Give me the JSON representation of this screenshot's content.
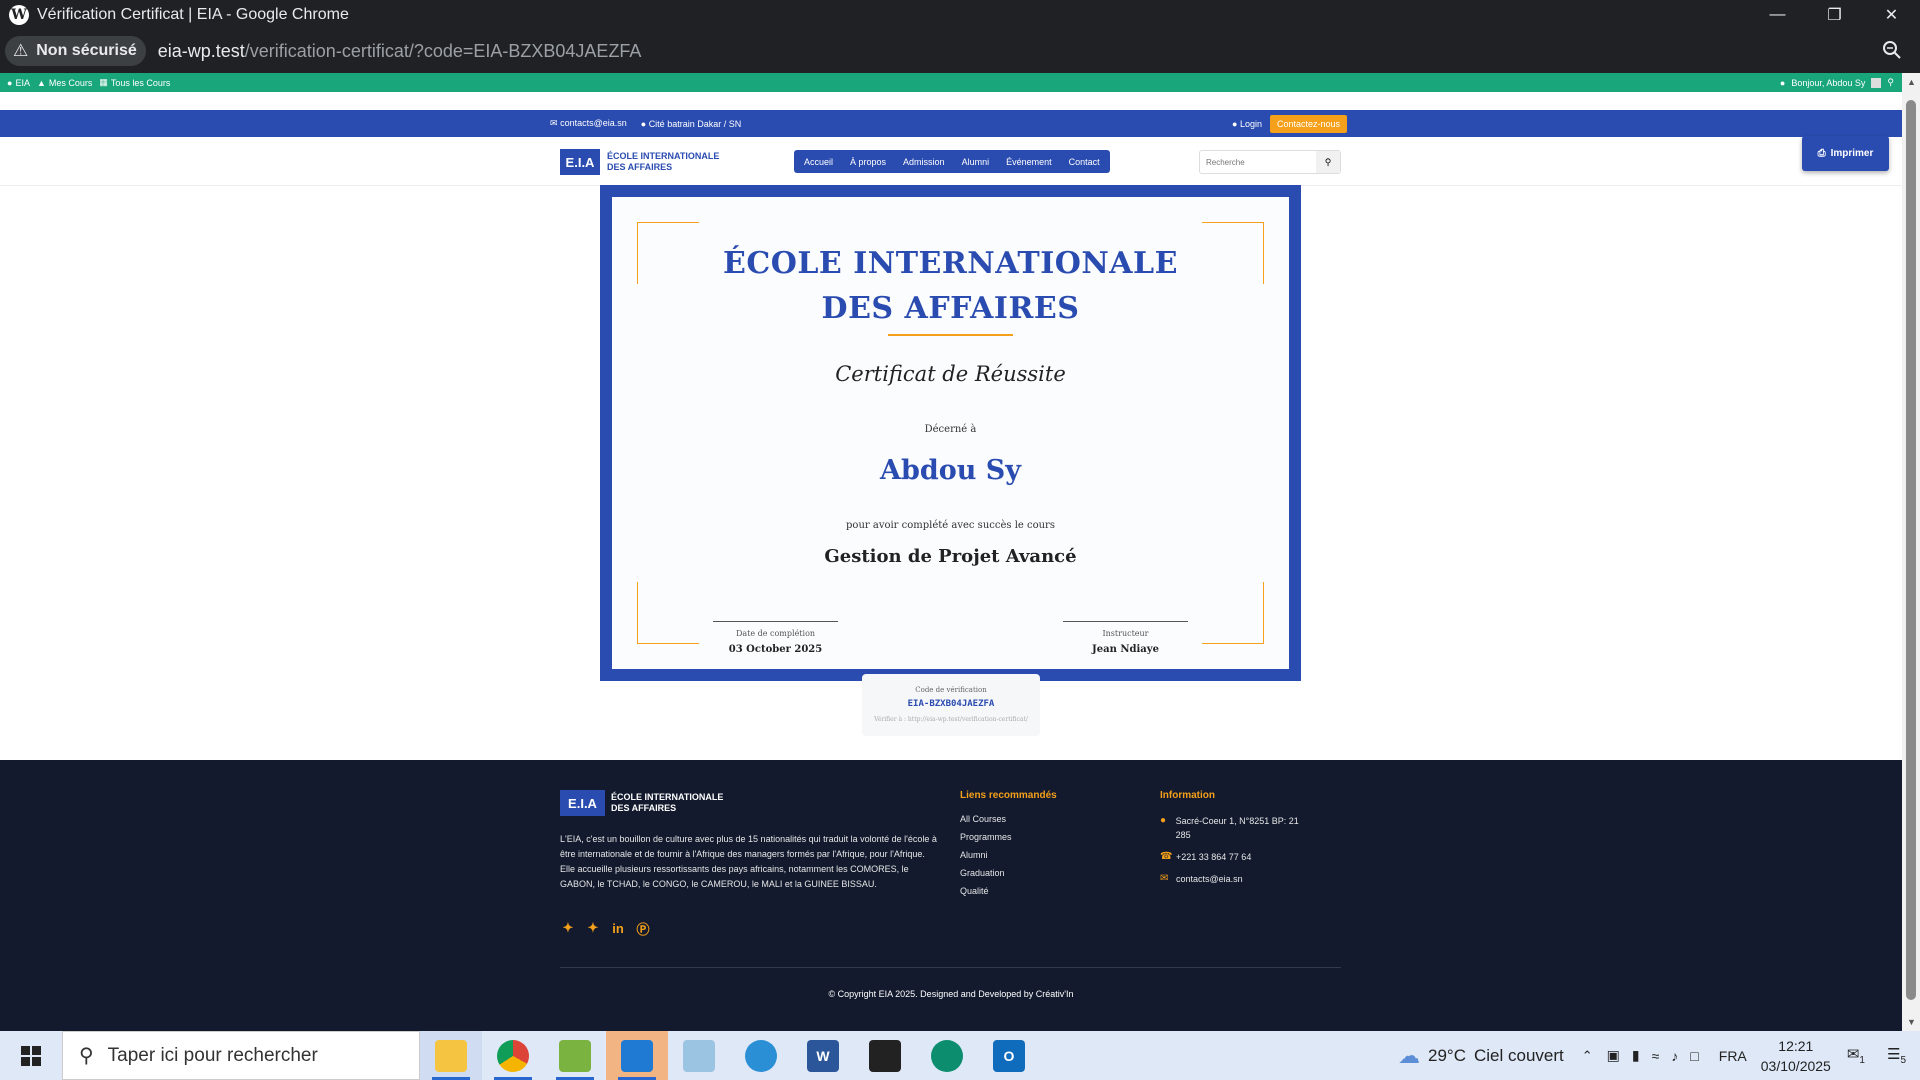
{
  "browser": {
    "tab_title": "Vérification Certificat | EIA - Google Chrome",
    "security_label": "Non sécurisé",
    "url_host": "eia-wp.test",
    "url_path": "/verification-certificat/?code=EIA-BZXB04JAEZFA"
  },
  "wp_admin_bar": {
    "site": "EIA",
    "my_courses": "Mes Cours",
    "all_courses": "Tous les Cours",
    "greeting": "Bonjour, Abdou Sy"
  },
  "topbar": {
    "email": "contacts@eia.sn",
    "location": "Cité batrain Dakar / SN",
    "login": "Login",
    "contact_cta": "Contactez-nous"
  },
  "header": {
    "logo_mark": "E.I.A",
    "logo_line1": "ÉCOLE INTERNATIONALE",
    "logo_line2": "DES AFFAIRES",
    "nav": [
      "Accueil",
      "À propos",
      "Admission",
      "Alumni",
      "Événement",
      "Contact"
    ],
    "search_placeholder": "Recherche",
    "print_label": "Imprimer"
  },
  "certificate": {
    "school_line1": "ÉCOLE INTERNATIONALE",
    "school_line2": "DES AFFAIRES",
    "title": "Certificat de Réussite",
    "awarded_to": "Décerné à",
    "recipient": "Abdou Sy",
    "completed_text": "pour avoir complété avec succès le cours",
    "course": "Gestion de Projet Avancé",
    "date_label": "Date de complétion",
    "date_value": "03 October 2025",
    "instructor_label": "Instructeur",
    "instructor_value": "Jean Ndiaye"
  },
  "verification": {
    "label": "Code de vérification",
    "code": "EIA-BZXB04JAEZFA",
    "verify_url": "Vérifier à : http://eia-wp.test/verification-certificat/"
  },
  "footer": {
    "logo_mark": "E.I.A",
    "logo_line1": "ÉCOLE INTERNATIONALE",
    "logo_line2": "DES AFFAIRES",
    "description": "L'EIA, c'est un bouillon de culture avec plus de 15 nationalités qui traduit la volonté de l'école à être internationale et de fournir à l'Afrique des managers formés par l'Afrique, pour l'Afrique. Elle accueille plusieurs ressortissants des pays africains, notamment les COMORES, le GABON, le TCHAD, le CONGO, le CAMEROU, le MALI et la GUINEE BISSAU.",
    "links_title": "Liens recommandés",
    "links": [
      "All Courses",
      "Programmes",
      "Alumni",
      "Graduation",
      "Qualité"
    ],
    "info_title": "Information",
    "address": "Sacré-Coeur 1, N°8251 BP: 21 285",
    "phone": "+221 33 864 77 64",
    "email": "contacts@eia.sn",
    "copyright": "© Copyright EIA 2025. Designed and Developed by Créativ'In"
  },
  "taskbar": {
    "search_placeholder": "Taper ici pour rechercher",
    "temperature": "29°C",
    "weather": "Ciel couvert",
    "language": "FRA",
    "time": "12:21",
    "date": "03/10/2025",
    "notif_count": "5",
    "mail_count": "1"
  },
  "colors": {
    "brand_blue": "#2a4bb0",
    "accent_orange": "#f5a01a",
    "admin_green": "#1aa67b",
    "footer_bg": "#131a2e"
  }
}
